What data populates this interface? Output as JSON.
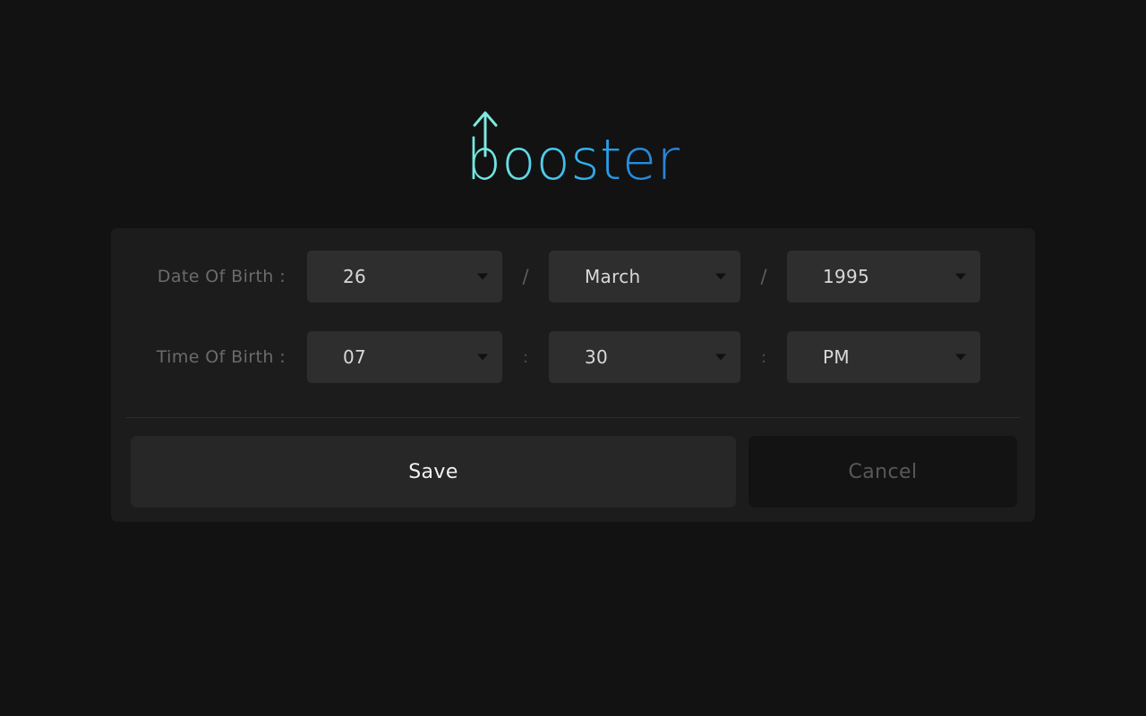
{
  "app": {
    "logo_text": "booster",
    "logo_icon": "up-arrow-icon",
    "logo_gradient_start": "#78ece2",
    "logo_gradient_end": "#2b7fd0",
    "background_color": "#121212",
    "card_color": "#1c1c1c"
  },
  "form": {
    "date_of_birth": {
      "label": "Date Of Birth :",
      "separator": "/",
      "day": {
        "value": "26",
        "name": "day-select"
      },
      "month": {
        "value": "March",
        "name": "month-select"
      },
      "year": {
        "value": "1995",
        "name": "year-select"
      }
    },
    "time_of_birth": {
      "label": "Time Of Birth :",
      "separator": ":",
      "hour": {
        "value": "07",
        "name": "hour-select"
      },
      "minute": {
        "value": "30",
        "name": "minute-select"
      },
      "meridiem": {
        "value": "PM",
        "name": "meridiem-select"
      }
    }
  },
  "actions": {
    "save_label": "Save",
    "cancel_label": "Cancel"
  }
}
